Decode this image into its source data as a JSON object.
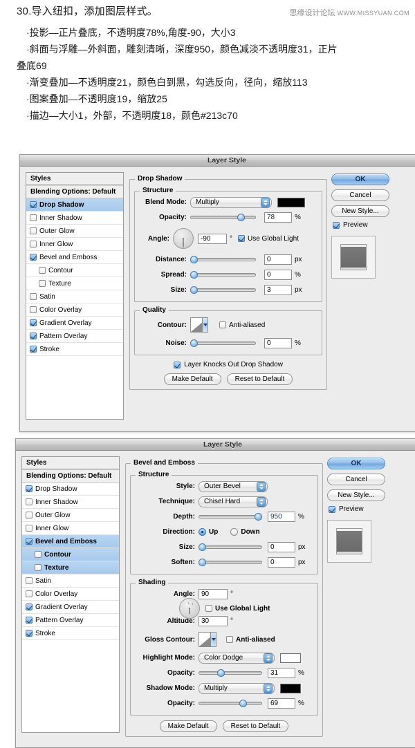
{
  "article": {
    "heading": "30.导入纽扣，添加图层样式。",
    "watermark_name": "思缘设计论坛",
    "watermark_site": "WWW.MISSYUAN.COM",
    "bullets": [
      "·投影—正片叠底，不透明度78%,角度-90，大小3",
      "·斜面与浮雕—外斜面，雕刻清晰，深度950，颜色减淡不透明度31，正片",
      "叠底69",
      "·渐变叠加—不透明度21，颜色白到黑，勾选反向，径向，缩放113",
      "·图案叠加—不透明度19，缩放25",
      "·描边—大小1，外部，不透明度18，颜色#213c70"
    ]
  },
  "dialog1": {
    "title": "Layer Style",
    "styles": {
      "header": "Styles",
      "blending": "Blending Options: Default",
      "items": [
        {
          "label": "Drop Shadow",
          "checked": true,
          "selected": true,
          "sub": false
        },
        {
          "label": "Inner Shadow",
          "checked": false,
          "selected": false,
          "sub": false
        },
        {
          "label": "Outer Glow",
          "checked": false,
          "selected": false,
          "sub": false
        },
        {
          "label": "Inner Glow",
          "checked": false,
          "selected": false,
          "sub": false
        },
        {
          "label": "Bevel and Emboss",
          "checked": true,
          "selected": false,
          "sub": false
        },
        {
          "label": "Contour",
          "checked": false,
          "selected": false,
          "sub": true
        },
        {
          "label": "Texture",
          "checked": false,
          "selected": false,
          "sub": true
        },
        {
          "label": "Satin",
          "checked": false,
          "selected": false,
          "sub": false
        },
        {
          "label": "Color Overlay",
          "checked": false,
          "selected": false,
          "sub": false
        },
        {
          "label": "Gradient Overlay",
          "checked": true,
          "selected": false,
          "sub": false
        },
        {
          "label": "Pattern Overlay",
          "checked": true,
          "selected": false,
          "sub": false
        },
        {
          "label": "Stroke",
          "checked": true,
          "selected": false,
          "sub": false
        }
      ]
    },
    "panel_title": "Drop Shadow",
    "structure_legend": "Structure",
    "blend_mode_label": "Blend Mode:",
    "blend_mode_value": "Multiply",
    "blend_color": "#000000",
    "opacity_label": "Opacity:",
    "opacity_value": "78",
    "opacity_unit": "%",
    "angle_label": "Angle:",
    "angle_value": "-90",
    "angle_unit": "°",
    "global_light_label": "Use Global Light",
    "global_light_checked": true,
    "distance_label": "Distance:",
    "distance_value": "0",
    "distance_unit": "px",
    "spread_label": "Spread:",
    "spread_value": "0",
    "spread_unit": "%",
    "size_label": "Size:",
    "size_value": "3",
    "size_unit": "px",
    "quality_legend": "Quality",
    "contour_label": "Contour:",
    "antialiased_label": "Anti-aliased",
    "antialiased_checked": false,
    "noise_label": "Noise:",
    "noise_value": "0",
    "noise_unit": "%",
    "knockout_label": "Layer Knocks Out Drop Shadow",
    "knockout_checked": true,
    "make_default": "Make Default",
    "reset_default": "Reset to Default",
    "ok": "OK",
    "cancel": "Cancel",
    "new_style": "New Style...",
    "preview": "Preview",
    "preview_checked": true
  },
  "dialog2": {
    "title": "Layer Style",
    "styles": {
      "header": "Styles",
      "blending": "Blending Options: Default",
      "items": [
        {
          "label": "Drop Shadow",
          "checked": true,
          "selected": false,
          "sub": false
        },
        {
          "label": "Inner Shadow",
          "checked": false,
          "selected": false,
          "sub": false
        },
        {
          "label": "Outer Glow",
          "checked": false,
          "selected": false,
          "sub": false
        },
        {
          "label": "Inner Glow",
          "checked": false,
          "selected": false,
          "sub": false
        },
        {
          "label": "Bevel and Emboss",
          "checked": true,
          "selected": true,
          "sub": false
        },
        {
          "label": "Contour",
          "checked": false,
          "selected": true,
          "sub": true
        },
        {
          "label": "Texture",
          "checked": false,
          "selected": true,
          "sub": true
        },
        {
          "label": "Satin",
          "checked": false,
          "selected": false,
          "sub": false
        },
        {
          "label": "Color Overlay",
          "checked": false,
          "selected": false,
          "sub": false
        },
        {
          "label": "Gradient Overlay",
          "checked": true,
          "selected": false,
          "sub": false
        },
        {
          "label": "Pattern Overlay",
          "checked": true,
          "selected": false,
          "sub": false
        },
        {
          "label": "Stroke",
          "checked": true,
          "selected": false,
          "sub": false
        }
      ]
    },
    "panel_title": "Bevel and Emboss",
    "structure_legend": "Structure",
    "style_label": "Style:",
    "style_value": "Outer Bevel",
    "technique_label": "Technique:",
    "technique_value": "Chisel Hard",
    "depth_label": "Depth:",
    "depth_value": "950",
    "depth_unit": "%",
    "direction_label": "Direction:",
    "direction_up": "Up",
    "direction_down": "Down",
    "direction_selected": "Up",
    "size_label": "Size:",
    "size_value": "0",
    "size_unit": "px",
    "soften_label": "Soften:",
    "soften_value": "0",
    "soften_unit": "px",
    "shading_legend": "Shading",
    "angle_label": "Angle:",
    "angle_value": "90",
    "angle_unit": "°",
    "global_light_label": "Use Global Light",
    "global_light_checked": false,
    "altitude_label": "Altitude:",
    "altitude_value": "30",
    "altitude_unit": "°",
    "gloss_contour_label": "Gloss Contour:",
    "antialiased_label": "Anti-aliased",
    "antialiased_checked": false,
    "highlight_mode_label": "Highlight Mode:",
    "highlight_mode_value": "Color Dodge",
    "highlight_color": "#ffffff",
    "highlight_opacity_label": "Opacity:",
    "highlight_opacity_value": "31",
    "highlight_opacity_unit": "%",
    "shadow_mode_label": "Shadow Mode:",
    "shadow_mode_value": "Multiply",
    "shadow_color": "#000000",
    "shadow_opacity_label": "Opacity:",
    "shadow_opacity_value": "69",
    "shadow_opacity_unit": "%",
    "make_default": "Make Default",
    "reset_default": "Reset to Default",
    "ok": "OK",
    "cancel": "Cancel",
    "new_style": "New Style...",
    "preview": "Preview",
    "preview_checked": true
  }
}
